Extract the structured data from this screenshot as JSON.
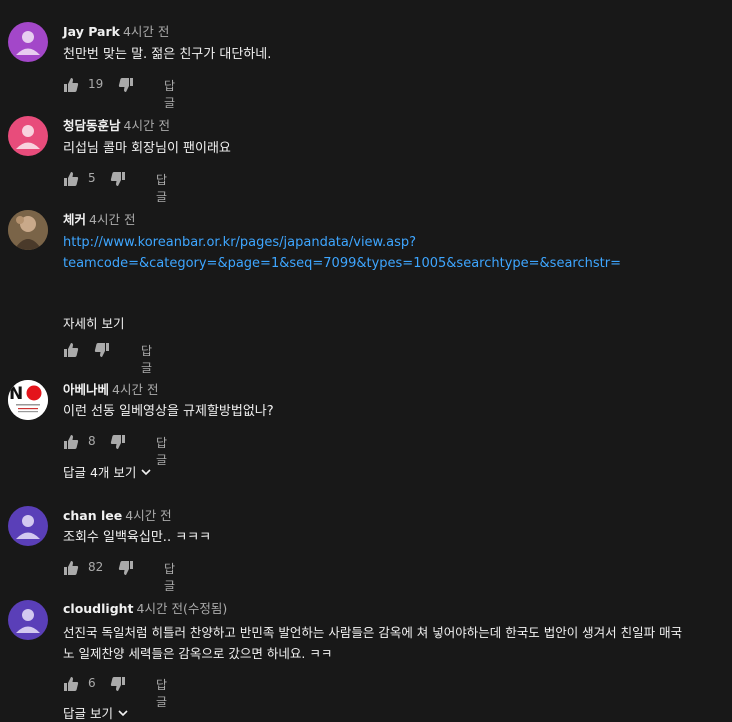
{
  "comments": [
    {
      "author": "Jay Park",
      "time": "4시간 전",
      "text": "천만번 맞는 말. 젊은 친구가 대단하네.",
      "likes": "19",
      "reply_label": "답글",
      "avatar_color": "#a347c9"
    },
    {
      "author": "청담동훈남",
      "time": "4시간 전",
      "text": "리섭님 콜마 회장님이 팬이래요",
      "likes": "5",
      "reply_label": "답글",
      "avatar_color": "#e84c7b"
    },
    {
      "author": "체커",
      "time": "4시간 전",
      "link_line1": "http://www.koreanbar.or.kr/pages/japandata/view.asp?",
      "link_line2": "teamcode=&category=&page=1&seq=7099&types=1005&searchtype=&searchstr=",
      "read_more": "자세히 보기",
      "reply_label": "답글"
    },
    {
      "author": "아베나베",
      "time": "4시간 전",
      "text": "이런 선동 일베영상을 규제할방법없나?",
      "likes": "8",
      "reply_label": "답글",
      "replies_label": "답글 4개 보기"
    },
    {
      "author": "chan lee",
      "time": "4시간 전",
      "text": "조회수 일백육십만.. ㅋㅋㅋ",
      "likes": "82",
      "reply_label": "답글",
      "avatar_color": "#5a3fb8"
    },
    {
      "author": "cloudlight",
      "time": "4시간 전(수정됨)",
      "text_line1": "선진국 독일처럼 히틀러 찬양하고 반민족 발언하는 사람들은 감옥에 쳐 넣어야하는데 한국도 법안이 생겨서 친일파 매국",
      "text_line2": "노 일제찬양 세력들은 감옥으로 갔으면 하네요. ㅋㅋ",
      "likes": "6",
      "reply_label": "답글",
      "replies_label": "답글 보기",
      "avatar_color": "#5a3fb8"
    }
  ],
  "colors": {
    "background": "#181818",
    "text": "#f1f1f1",
    "secondary": "#aaaaaa",
    "link": "#3ea6ff"
  }
}
